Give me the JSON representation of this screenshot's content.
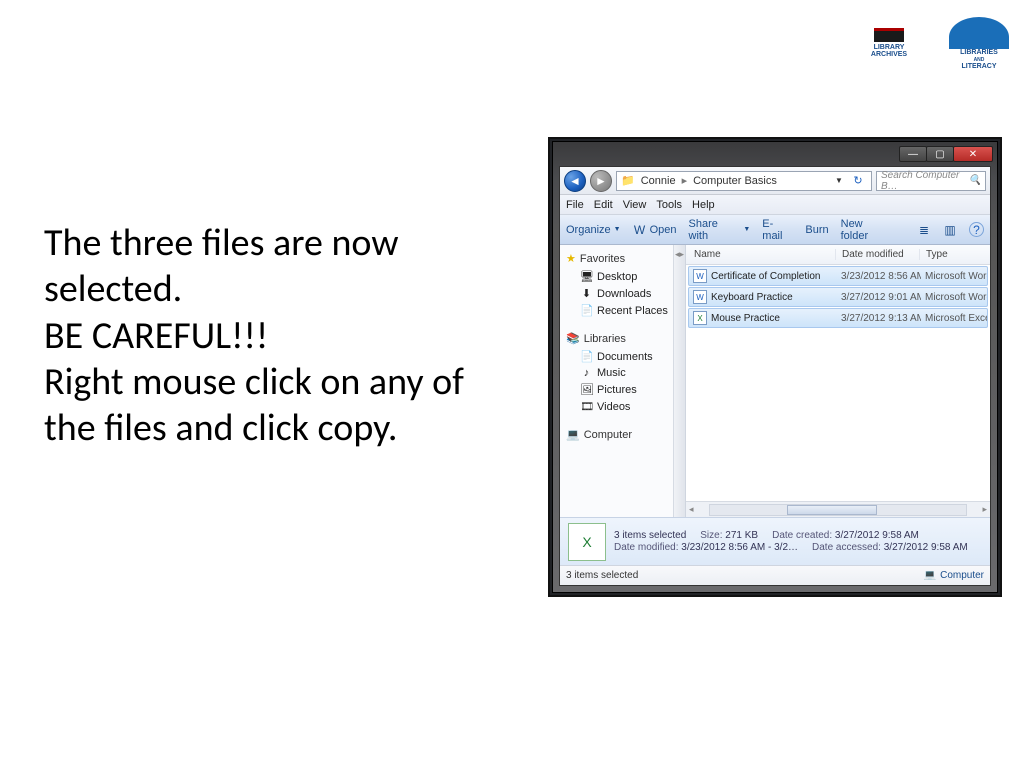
{
  "logos": {
    "left": "LIBRARY\nARCHIVES",
    "right": "LIBRARIES\nAND\nLITERACY"
  },
  "instruction": {
    "l1": "The three files are now selected.",
    "l2": "BE CAREFUL!!!",
    "l3": "Right mouse click on any of the files and click copy."
  },
  "explorer": {
    "breadcrumb": {
      "a": "Connie",
      "b": "Computer Basics"
    },
    "search_placeholder": "Search Computer B…",
    "menu": [
      "File",
      "Edit",
      "View",
      "Tools",
      "Help"
    ],
    "toolbar": {
      "organize": "Organize",
      "open": "Open",
      "share": "Share with",
      "email": "E-mail",
      "burn": "Burn",
      "newfolder": "New folder"
    },
    "nav": {
      "favorites": "Favorites",
      "desktop": "Desktop",
      "downloads": "Downloads",
      "recent": "Recent Places",
      "libraries": "Libraries",
      "documents": "Documents",
      "music": "Music",
      "pictures": "Pictures",
      "videos": "Videos",
      "computer": "Computer"
    },
    "columns": {
      "name": "Name",
      "date": "Date modified",
      "type": "Type"
    },
    "files": [
      {
        "name": "Certificate of Completion",
        "date": "3/23/2012 8:56 AM",
        "type": "Microsoft Word D…",
        "kind": "doc"
      },
      {
        "name": "Keyboard Practice",
        "date": "3/27/2012 9:01 AM",
        "type": "Microsoft Word D…",
        "kind": "doc"
      },
      {
        "name": "Mouse Practice",
        "date": "3/27/2012 9:13 AM",
        "type": "Microsoft Excel W…",
        "kind": "xls"
      }
    ],
    "details": {
      "title": "3 items selected",
      "size_label": "Size:",
      "size": "271 KB",
      "created_label": "Date created:",
      "created": "3/27/2012 9:58 AM",
      "modified_label": "Date modified:",
      "modified": "3/23/2012 8:56 AM - 3/2…",
      "accessed_label": "Date accessed:",
      "accessed": "3/27/2012 9:58 AM"
    },
    "status": {
      "left": "3 items selected",
      "right": "Computer"
    }
  }
}
